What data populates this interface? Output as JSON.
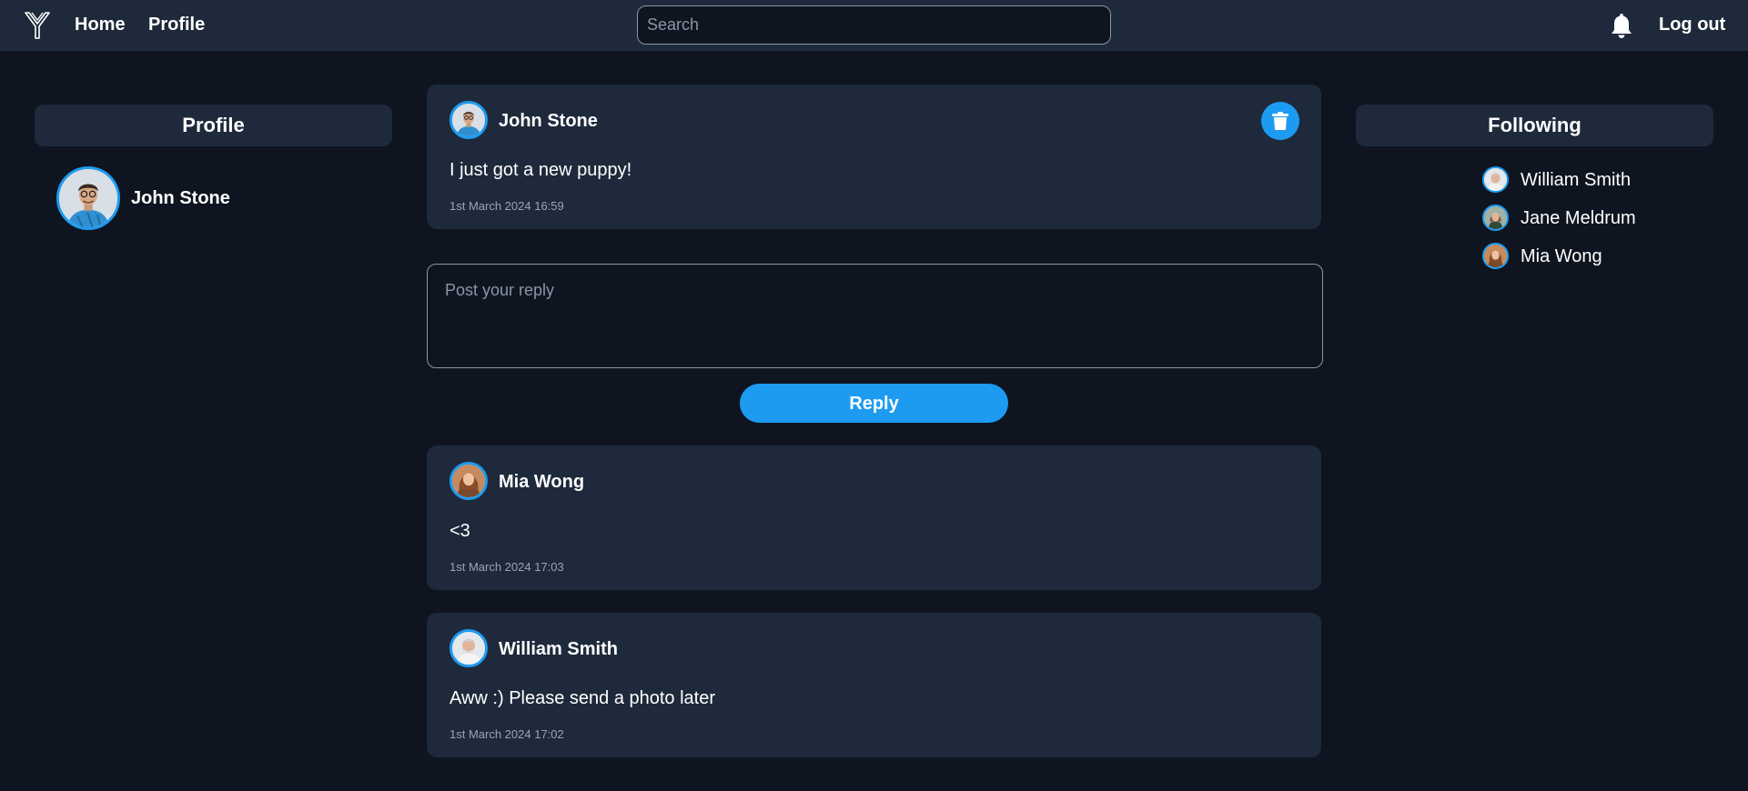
{
  "nav": {
    "logo_icon": "y-logo-icon",
    "home_label": "Home",
    "profile_label": "Profile",
    "search_placeholder": "Search",
    "search_value": "",
    "notifications_icon": "bell-icon",
    "logout_label": "Log out"
  },
  "profile_panel": {
    "title": "Profile",
    "user": {
      "name": "John Stone",
      "avatar": "john-stone-avatar"
    }
  },
  "following_panel": {
    "title": "Following",
    "users": [
      {
        "name": "William Smith",
        "avatar": "william-smith-avatar"
      },
      {
        "name": "Jane Meldrum",
        "avatar": "jane-meldrum-avatar"
      },
      {
        "name": "Mia Wong",
        "avatar": "mia-wong-avatar"
      }
    ]
  },
  "main_post": {
    "author": "John Stone",
    "text": "I just got a new puppy!",
    "timestamp": "1st March 2024 16:59",
    "delete_icon": "trash-icon"
  },
  "reply_form": {
    "placeholder": "Post your reply",
    "value": "",
    "button_label": "Reply"
  },
  "replies": [
    {
      "author": "Mia Wong",
      "text": "<3",
      "timestamp": "1st March 2024 17:03"
    },
    {
      "author": "William Smith",
      "text": "Aww :) Please send a photo later",
      "timestamp": "1st March 2024 17:02"
    }
  ],
  "colors": {
    "accent": "#1d9bf0",
    "background": "#0e1520",
    "card": "#1e2a3b",
    "muted_text": "#9aa5b4"
  }
}
